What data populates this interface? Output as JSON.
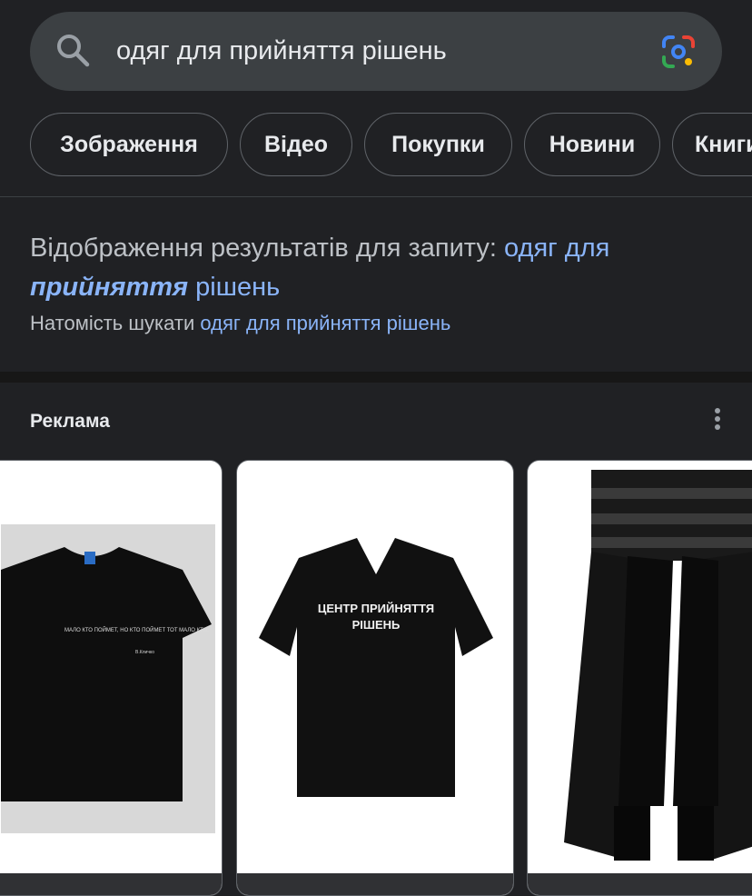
{
  "search": {
    "query": "одяг для прийняття рішень"
  },
  "chips": [
    {
      "label": "Зображення"
    },
    {
      "label": "Відео"
    },
    {
      "label": "Покупки"
    },
    {
      "label": "Новини"
    },
    {
      "label": "Книги"
    }
  ],
  "spelling": {
    "prefix": "Відображення результатів для запиту:",
    "query_part1": "одяг для",
    "query_bold": "прийняття",
    "query_part2": "рішень",
    "instead_prefix": "Натомість шукати",
    "instead_link": "одяг для прийняття рішень"
  },
  "ads": {
    "label": "Реклама",
    "products": [
      {
        "image": "black-tshirt-with-quote",
        "shirt_text": "МАЛО КТО ПОЙМЕТ, НО КТО ПОЙМЕТ ТОТ МАЛО КТО.",
        "signature": "В.Кличко"
      },
      {
        "image": "black-vneck-tshirt",
        "shirt_text_line1": "ЦЕНТР ПРИЙНЯТТЯ",
        "shirt_text_line2": "РІШЕНЬ"
      },
      {
        "image": "gothic-skirt-outfit"
      }
    ]
  },
  "colors": {
    "background": "#202124",
    "link": "#8ab4f8",
    "chip_border": "#5f6368",
    "search_bg": "#3c4043"
  }
}
